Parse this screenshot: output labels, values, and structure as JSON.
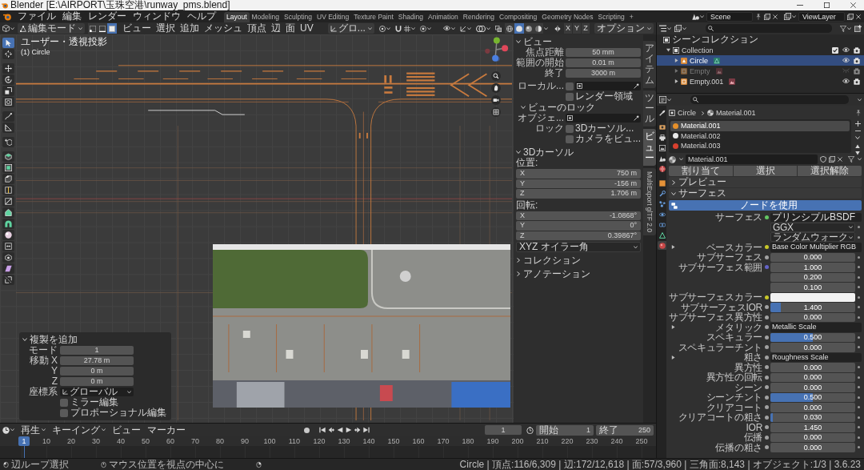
{
  "window": {
    "title": "Blender [E:\\AIRPORT\\玉珠空港\\runway_pms.blend]"
  },
  "menu": [
    "ファイル",
    "編集",
    "レンダー",
    "ウィンドウ",
    "ヘルプ"
  ],
  "workspaces": [
    {
      "label": "Layout",
      "selected": true
    },
    {
      "label": "Modeling",
      "selected": false
    },
    {
      "label": "Sculpting",
      "selected": false
    },
    {
      "label": "UV Editing",
      "selected": false
    },
    {
      "label": "Texture Paint",
      "selected": false
    },
    {
      "label": "Shading",
      "selected": false
    },
    {
      "label": "Animation",
      "selected": false
    },
    {
      "label": "Rendering",
      "selected": false
    },
    {
      "label": "Compositing",
      "selected": false
    },
    {
      "label": "Geometry Nodes",
      "selected": false
    },
    {
      "label": "Scripting",
      "selected": false
    }
  ],
  "add_workspace": "+",
  "scene": "Scene",
  "view_layer": "ViewLayer",
  "viewport": {
    "mode": "編集モード",
    "select_modes": [
      {
        "kind": "vertex",
        "selected": false
      },
      {
        "kind": "edge",
        "selected": false
      },
      {
        "kind": "face",
        "selected": true
      }
    ],
    "menus": [
      "ビュー",
      "選択",
      "追加",
      "メッシュ",
      "頂点",
      "辺",
      "面",
      "UV"
    ],
    "orientation": "グロ...",
    "shading": [
      {
        "kind": "wireframe",
        "selected": false
      },
      {
        "kind": "solid",
        "selected": true
      },
      {
        "kind": "material",
        "selected": false
      },
      {
        "kind": "rendered",
        "selected": false
      }
    ],
    "mirror_axes": [
      {
        "label": "X",
        "selected": false
      },
      {
        "label": "Y",
        "selected": false
      },
      {
        "label": "Z",
        "selected": false
      }
    ],
    "options": "オプション",
    "view_name": "ユーザー・透視投影",
    "object_name": "(1) Circle",
    "tool_groups": [
      [
        {
          "kind": "select",
          "selected": true
        },
        {
          "kind": "cursor",
          "selected": false
        }
      ],
      [
        {
          "kind": "move",
          "selected": false
        },
        {
          "kind": "rotate",
          "selected": false
        },
        {
          "kind": "scale",
          "selected": false
        },
        {
          "kind": "transform",
          "selected": false
        }
      ],
      [
        {
          "kind": "annotate",
          "selected": false
        },
        {
          "kind": "measure",
          "selected": false
        }
      ],
      [
        {
          "kind": "add",
          "selected": false
        }
      ],
      [
        {
          "kind": "extrude",
          "selected": false
        },
        {
          "kind": "inset",
          "selected": false
        },
        {
          "kind": "bevel",
          "selected": false
        },
        {
          "kind": "loopcut",
          "selected": false
        },
        {
          "kind": "knife",
          "selected": false
        },
        {
          "kind": "polybuild",
          "selected": false
        },
        {
          "kind": "spin",
          "selected": false
        },
        {
          "kind": "smooth",
          "selected": false
        },
        {
          "kind": "slide",
          "selected": false
        },
        {
          "kind": "shrink",
          "selected": false
        },
        {
          "kind": "shear",
          "selected": false
        },
        {
          "kind": "rip",
          "selected": false
        }
      ]
    ],
    "sidebar_tabs": [
      {
        "label": "アイテム",
        "kind": "stacked",
        "selected": false
      },
      {
        "label": "ツール",
        "kind": "stacked",
        "selected": false
      },
      {
        "label": "ビュー",
        "kind": "stacked",
        "selected": true
      },
      {
        "label": "MultiExport glTF 2.0",
        "kind": "rotated",
        "selected": false
      }
    ],
    "sidebar": {
      "view": {
        "title": "ビュー",
        "expanded": true,
        "fields": [
          {
            "label": "焦点距離",
            "value": "50 mm"
          },
          {
            "label": "範囲の開始",
            "value": "0.01 m"
          },
          {
            "label": "終了",
            "value": "3000 m"
          }
        ],
        "local_camera": {
          "label": "ローカル...",
          "checked": false
        },
        "render_region": {
          "label": "レンダー領域",
          "checked": false
        },
        "lock": {
          "title": "ビューのロック",
          "expanded": true,
          "object_label": "オブジェ...",
          "lock_label": "ロック",
          "options": [
            {
              "label": "3Dカーソル...",
              "checked": false
            },
            {
              "label": "カメラをビュ...",
              "checked": false
            }
          ]
        }
      },
      "cursor": {
        "title": "3Dカーソル",
        "expanded": true,
        "location_label": "位置:",
        "location": [
          {
            "axis": "X",
            "value": "750 m"
          },
          {
            "axis": "Y",
            "value": "-156 m"
          },
          {
            "axis": "Z",
            "value": "1.706 m"
          }
        ],
        "rotation_label": "回転:",
        "rotation": [
          {
            "axis": "X",
            "value": "-1.0868°"
          },
          {
            "axis": "Y",
            "value": "0°"
          },
          {
            "axis": "Z",
            "value": "0.39867°"
          }
        ],
        "rotation_mode": "XYZ オイラー角"
      },
      "more": [
        {
          "title": "コレクション",
          "expanded": false
        },
        {
          "title": "アノテーション",
          "expanded": false
        }
      ]
    },
    "last_operator": {
      "title": "複製を追加",
      "expanded": true,
      "fields": [
        {
          "label": "モード",
          "value": "1"
        },
        {
          "label": "移動 X",
          "value": "27.78 m"
        },
        {
          "label": "Y",
          "value": "0 m"
        },
        {
          "label": "Z",
          "value": "0 m"
        }
      ],
      "orientation_label": "座標系",
      "orientation": "グローバル",
      "options": [
        {
          "label": "ミラー編集",
          "checked": false
        },
        {
          "label": "プロポーショナル編集",
          "checked": false
        }
      ]
    }
  },
  "outliner": {
    "root": "シーンコレクション",
    "children": [
      {
        "name": "Collection",
        "expanded": true,
        "checked": true,
        "children": [
          {
            "name": "Circle",
            "kind": "mesh",
            "selected": true,
            "visible": true,
            "expanded": false
          },
          {
            "name": "Empty",
            "kind": "image",
            "selected": false,
            "visible": false,
            "expanded": false
          },
          {
            "name": "Empty.001",
            "kind": "image",
            "selected": false,
            "visible": true,
            "expanded": false
          }
        ]
      }
    ]
  },
  "properties": {
    "tab_groups": [
      [
        {
          "kind": "tool",
          "selected": false
        }
      ],
      [
        {
          "kind": "render",
          "selected": false
        },
        {
          "kind": "output",
          "selected": false
        },
        {
          "kind": "view_layer",
          "selected": false
        },
        {
          "kind": "scene",
          "selected": false
        },
        {
          "kind": "world",
          "selected": false
        }
      ],
      [
        {
          "kind": "object",
          "selected": false
        },
        {
          "kind": "modifiers",
          "selected": false
        },
        {
          "kind": "particles",
          "selected": false
        },
        {
          "kind": "physics",
          "selected": false
        },
        {
          "kind": "constraints",
          "selected": false
        },
        {
          "kind": "data",
          "selected": false
        },
        {
          "kind": "material",
          "selected": true
        }
      ]
    ],
    "breadcrumb": [
      {
        "label": "Circle",
        "kind": "object"
      },
      {
        "label": "Material.001",
        "kind": "material"
      }
    ],
    "material_slots": [
      {
        "name": "Material.001",
        "color": "#e6902a",
        "selected": true
      },
      {
        "name": "Material.002",
        "color": "#e8e8e8",
        "selected": false
      },
      {
        "name": "Material.003",
        "color": "#d8402e",
        "selected": false
      }
    ],
    "material": "Material.001",
    "slot_buttons": [
      "割り当て",
      "選択",
      "選択解除"
    ],
    "preview": {
      "title": "プレビュー",
      "expanded": false
    },
    "surface": {
      "title": "サーフェス",
      "expanded": true,
      "use_nodes": "ノードを使用",
      "shader": {
        "label": "サーフェス",
        "value": "プリンシプルBSDF",
        "color": "#63c763"
      },
      "options": [
        "GGX",
        "ランダムウォーク"
      ],
      "inputs": [
        {
          "kind": "link",
          "label": "ベースカラー",
          "value": "Base Color Multiplier RGB",
          "color": "#c7c729",
          "expanded": false
        },
        {
          "kind": "value",
          "label": "サブサーフェス",
          "value": "0.000",
          "color": "#a1a1a1"
        },
        {
          "kind": "vector",
          "label": "サブサーフェス範囲",
          "values": [
            "1.000",
            "0.200",
            "0.100"
          ],
          "color": "#6363c7"
        },
        {
          "kind": "color",
          "label": "サブサーフェスカラー",
          "color": "#c7c729",
          "swatch": {
            "color": "#f2f2f2"
          }
        },
        {
          "kind": "value",
          "label": "サブサーフェスIOR",
          "value": "1.400",
          "level": 0.12,
          "color": "#a1a1a1"
        },
        {
          "kind": "value",
          "label": "サブサーフェス異方性",
          "value": "0.000",
          "color": "#a1a1a1"
        },
        {
          "kind": "link",
          "label": "メタリック",
          "value": "Metallic Scale",
          "color": "#a1a1a1",
          "expanded": false
        },
        {
          "kind": "value",
          "label": "スペキュラー",
          "value": "0.500",
          "level": 0.5,
          "color": "#a1a1a1"
        },
        {
          "kind": "value",
          "label": "スペキュラーチント",
          "value": "0.000",
          "color": "#a1a1a1"
        },
        {
          "kind": "link",
          "label": "粗さ",
          "value": "Roughness Scale",
          "color": "#a1a1a1",
          "expanded": false
        },
        {
          "kind": "value",
          "label": "異方性",
          "value": "0.000",
          "color": "#a1a1a1"
        },
        {
          "kind": "value",
          "label": "異方性の回転",
          "value": "0.000",
          "color": "#a1a1a1"
        },
        {
          "kind": "value",
          "label": "シーン",
          "value": "0.000",
          "color": "#a1a1a1"
        },
        {
          "kind": "value",
          "label": "シーンチント",
          "value": "0.500",
          "level": 0.5,
          "color": "#a1a1a1"
        },
        {
          "kind": "value",
          "label": "クリアコート",
          "value": "0.000",
          "color": "#a1a1a1"
        },
        {
          "kind": "value",
          "label": "クリアコートの粗さ",
          "value": "0.030",
          "level": 0.03,
          "color": "#a1a1a1"
        },
        {
          "kind": "value",
          "label": "IOR",
          "value": "1.450",
          "color": "#a1a1a1"
        },
        {
          "kind": "value",
          "label": "伝播",
          "value": "0.000",
          "color": "#a1a1a1"
        },
        {
          "kind": "value",
          "label": "伝播の粗さ",
          "value": "0.000",
          "color": "#a1a1a1"
        }
      ]
    }
  },
  "timeline": {
    "menus": [
      {
        "label": "再生",
        "kind": "dropdown"
      },
      {
        "label": "キーイング",
        "kind": "dropdown"
      },
      {
        "label": "ビュー",
        "kind": "menu"
      },
      {
        "label": "マーカー",
        "kind": "menu"
      }
    ],
    "auto_keying": false,
    "current_frame": "1",
    "start_label": "開始",
    "start": "1",
    "end_label": "終了",
    "end": "250",
    "playhead": "1",
    "ticks": [
      "10",
      "20",
      "30",
      "40",
      "50",
      "60",
      "70",
      "80",
      "90",
      "100",
      "110",
      "120",
      "130",
      "140",
      "150",
      "160",
      "170",
      "180",
      "190",
      "200",
      "210",
      "220",
      "230",
      "240",
      "250"
    ]
  },
  "status_bar": {
    "hints": [
      {
        "kind": "mouse-left",
        "label": "辺ループ選択"
      },
      {
        "kind": "mouse-middle",
        "label": "マウス位置を視点の中心に"
      },
      {
        "kind": "mouse-right"
      }
    ],
    "stats": "Circle | 頂点:116/6,309 | 辺:172/12,618 | 面:57/3,960 | 三角面:8,143 | オブジェクト:1/3 | 3.6.23"
  }
}
